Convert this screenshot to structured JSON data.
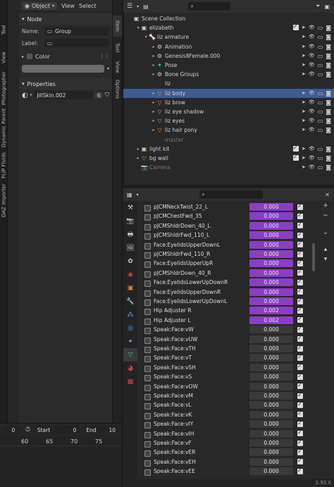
{
  "left_tabs": [
    "Tool",
    "View",
    "Photographer",
    "Dynamic Parent",
    "FLIP Fluids",
    "DAZ Importer"
  ],
  "viewport_header": {
    "mode": "Object",
    "menus": [
      "View",
      "Select"
    ]
  },
  "n_tabs": [
    "Item",
    "Tool",
    "View",
    "Options"
  ],
  "npanel": {
    "node_header": "Node",
    "name_label": "Name:",
    "name_value": "Group",
    "label_label": "Label:",
    "label_value": "",
    "color_label": "Color",
    "properties_header": "Properties",
    "material_value": "JillSkin.002",
    "material_users": "6"
  },
  "timeline": {
    "frame": "0",
    "start_label": "Start",
    "start": "0",
    "end_label": "End",
    "end": "10",
    "ticks": [
      "60",
      "65",
      "70",
      "75"
    ]
  },
  "outliner": {
    "search_placeholder": "",
    "rows": [
      {
        "label": "Scene Collection",
        "indent": 0,
        "icon": "▣",
        "kind": "plain"
      },
      {
        "label": "elizabeth",
        "indent": 1,
        "icon": "▣",
        "kind": "plain",
        "tri": "▾"
      },
      {
        "label": "liz armature",
        "indent": 2,
        "icon": "🦴",
        "kind": "plain",
        "tri": "▾"
      },
      {
        "label": "Animation",
        "indent": 3,
        "icon": "⚙",
        "kind": "plain",
        "tri": "▸"
      },
      {
        "label": "Genesis8Female.000",
        "indent": 3,
        "icon": "⚙",
        "kind": "plain",
        "tri": "▸"
      },
      {
        "label": "Pose",
        "indent": 3,
        "icon": "✦",
        "kind": "plain",
        "tri": "▸"
      },
      {
        "label": "Bone Groups",
        "indent": 3,
        "icon": "⚙",
        "kind": "plain",
        "tri": "▸"
      },
      {
        "label": "liz",
        "indent": 3,
        "icon": "",
        "kind": "plain"
      },
      {
        "label": "liz body",
        "indent": 3,
        "icon": "▽",
        "kind": "sel",
        "tri": "▸"
      },
      {
        "label": "liz brow",
        "indent": 3,
        "icon": "▽",
        "kind": "plain",
        "tri": "▸"
      },
      {
        "label": "liz eye shadow",
        "indent": 3,
        "icon": "▽",
        "kind": "plain",
        "tri": "▸"
      },
      {
        "label": "liz eyes",
        "indent": 3,
        "icon": "▽",
        "kind": "plain",
        "tri": "▸"
      },
      {
        "label": "liz hair pony",
        "indent": 3,
        "icon": "▽",
        "kind": "plain",
        "tri": "▸"
      },
      {
        "label": "master",
        "indent": 3,
        "icon": "",
        "kind": "dim"
      },
      {
        "label": "light kit",
        "indent": 1,
        "icon": "▣",
        "kind": "plain",
        "tri": "▸"
      },
      {
        "label": "bg wall",
        "indent": 1,
        "icon": "▽",
        "kind": "plain",
        "tri": "▸"
      },
      {
        "label": "Camera",
        "indent": 1,
        "icon": "📷",
        "kind": "dim"
      }
    ]
  },
  "properties": {
    "search_placeholder": "",
    "shape_keys": [
      {
        "name": "pJCMNeckTwist_22_L",
        "value": "0.000",
        "purple": true
      },
      {
        "name": "pJCMChestFwd_35",
        "value": "0.000",
        "purple": true
      },
      {
        "name": "pJCMShldrDown_40_L",
        "value": "0.000",
        "purple": true
      },
      {
        "name": "pJCMShldrFwd_110_L",
        "value": "0.000",
        "purple": true
      },
      {
        "name": "Face:EyelidsUpperDownL",
        "value": "0.000",
        "purple": true
      },
      {
        "name": "pJCMShldrFwd_110_R",
        "value": "0.000",
        "purple": true
      },
      {
        "name": "Face:EyelidsUpperUpR",
        "value": "0.000",
        "purple": true
      },
      {
        "name": "pJCMShldrDown_40_R",
        "value": "0.000",
        "purple": true
      },
      {
        "name": "Face:EyelidsLowerUpDownR",
        "value": "0.000",
        "purple": true
      },
      {
        "name": "Face:EyelidsUpperDownR",
        "value": "0.000",
        "purple": true
      },
      {
        "name": "Face:EyelidsLowerUpDownL",
        "value": "0.000",
        "purple": true
      },
      {
        "name": "Hip Adjuster R",
        "value": "0.002",
        "purple": true
      },
      {
        "name": "Hip Adjuster L",
        "value": "0.002",
        "purple": true
      },
      {
        "name": "Speak:Face:vW",
        "value": "0.000",
        "purple": false
      },
      {
        "name": "Speak:Face:vUW",
        "value": "0.000",
        "purple": false
      },
      {
        "name": "Speak:Face:vTH",
        "value": "0.000",
        "purple": false
      },
      {
        "name": "Speak:Face:vT",
        "value": "0.000",
        "purple": false
      },
      {
        "name": "Speak:Face:vSH",
        "value": "0.000",
        "purple": false
      },
      {
        "name": "Speak:Face:vS",
        "value": "0.000",
        "purple": false
      },
      {
        "name": "Speak:Face:vOW",
        "value": "0.000",
        "purple": false
      },
      {
        "name": "Speak:Face:vM",
        "value": "0.000",
        "purple": false
      },
      {
        "name": "Speak:Face:vL",
        "value": "0.000",
        "purple": false
      },
      {
        "name": "Speak:Face:vK",
        "value": "0.000",
        "purple": false
      },
      {
        "name": "Speak:Face:vIY",
        "value": "0.000",
        "purple": false
      },
      {
        "name": "Speak:Face:vIH",
        "value": "0.000",
        "purple": false
      },
      {
        "name": "Speak:Face:vF",
        "value": "0.000",
        "purple": false
      },
      {
        "name": "Speak:Face:vER",
        "value": "0.000",
        "purple": false
      },
      {
        "name": "Speak:Face:vEH",
        "value": "0.000",
        "purple": false
      },
      {
        "name": "Speak:Face:vEE",
        "value": "0.000",
        "purple": false
      }
    ]
  },
  "status": {
    "version": "2.92.0"
  },
  "colors": {
    "accent_purple": "#8a3fc2",
    "selection_blue": "#3e5c91",
    "mesh_orange": "#e08a3c",
    "modifier_green": "#3fc99a"
  }
}
